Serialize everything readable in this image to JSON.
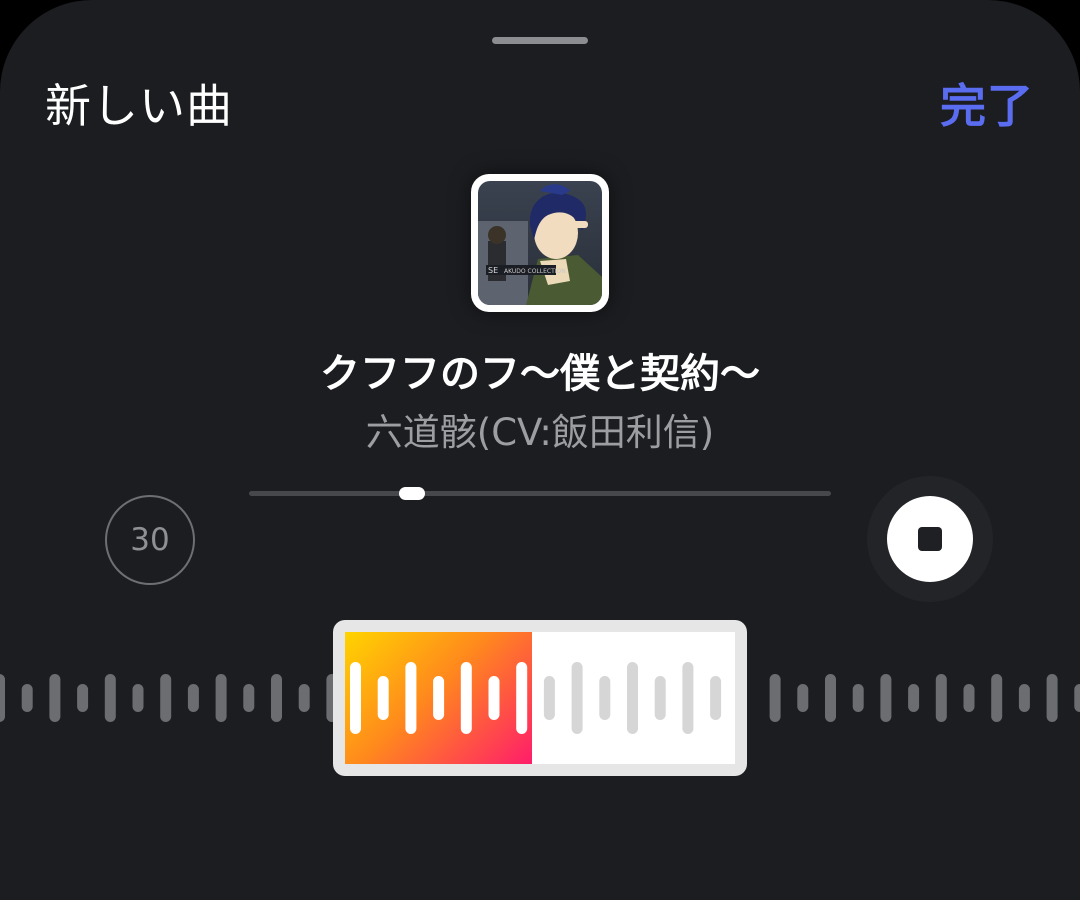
{
  "header": {
    "title": "新しい曲",
    "done_label": "完了"
  },
  "track": {
    "title": "クフフのフ〜僕と契約〜",
    "artist": "六道骸(CV:飯田利信)",
    "artwork": "anime-character-album-art"
  },
  "controls": {
    "clip_duration": "30",
    "stop_icon": "stop-icon"
  },
  "playback": {
    "position_fraction": 0.28,
    "clip_played_fraction": 0.48
  },
  "colors": {
    "accent": "#5a6cf0",
    "gradient_start": "#ffd400",
    "gradient_mid": "#ff8a1c",
    "gradient_end": "#ff1d6a"
  }
}
